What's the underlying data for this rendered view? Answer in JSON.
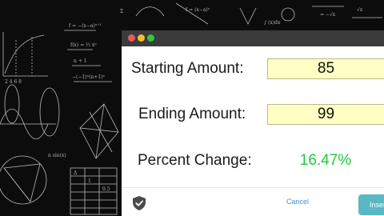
{
  "window": {
    "traffic_lights": [
      "#ef5a52",
      "#f5bf2e",
      "#2bc940"
    ]
  },
  "form": {
    "starting_label": "Starting Amount:",
    "starting_value": "85",
    "ending_label": "Ending Amount:",
    "ending_value": "99",
    "percent_label": "Percent Change:",
    "percent_value": "16.47%"
  },
  "footer": {
    "shield_icon": "shield-check-icon",
    "cancel_label": "Cancel",
    "insert_label": "Insert"
  },
  "colors": {
    "result_green": "#26c63e",
    "field_yellow": "#ffffc4",
    "insert_teal": "#59b8c4",
    "cancel_blue": "#4a90c9"
  }
}
